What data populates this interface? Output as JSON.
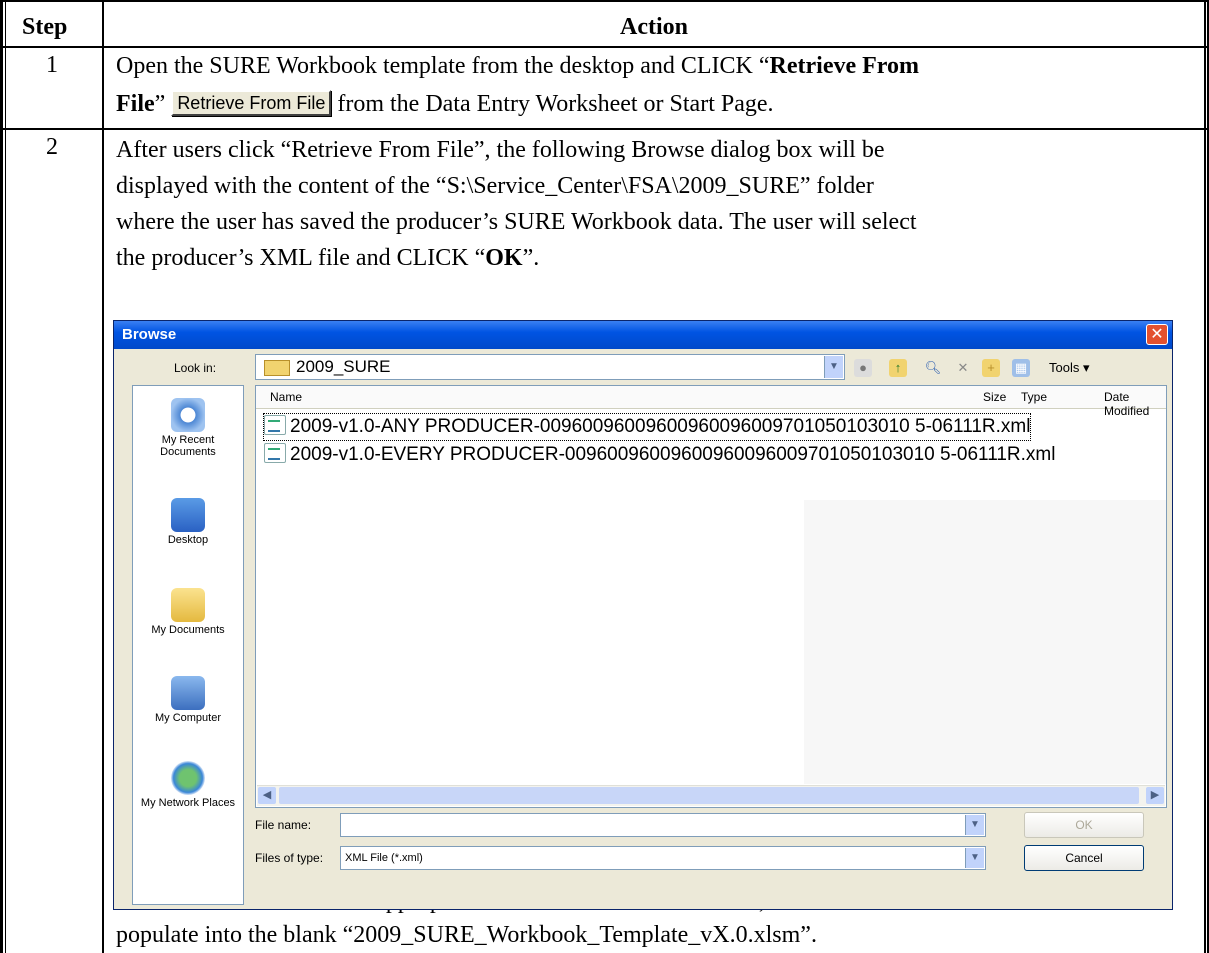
{
  "table": {
    "header_step": "Step",
    "header_action": "Action"
  },
  "step1": {
    "number": "1",
    "line1_pre": "Open the SURE Workbook template from the desktop and CLICK “",
    "line1_bold": "Retrieve From",
    "line2_bold": "File",
    "line2_mid": "”",
    "button_label": "Retrieve From File",
    "line2_post": "from the Data Entry Worksheet or Start Page."
  },
  "step2": {
    "number": "2",
    "line1": "After users click “Retrieve From File”, the following Browse dialog box will be",
    "line2": "displayed with the content of the “S:\\Service_Center\\FSA\\2009_SURE” folder",
    "line3": "where the user has saved the producer’s SURE Workbook data.  The user will select",
    "line4_pre": "the producer’s XML file and CLICK “",
    "line4_bold": "OK",
    "line4_post": "”.",
    "after_line1": "After user has selected the appropriate XML file and clicked “OK”, the data will",
    "after_line2": "populate into the blank “2009_SURE_Workbook_Template_vX.0.xlsm”."
  },
  "dialog": {
    "title": "Browse",
    "close_icon": "close-icon",
    "look_in_label": "Look in:",
    "look_in_value": "2009_SURE",
    "tools_label": "Tools ▾",
    "places": [
      "My Recent Documents",
      "Desktop",
      "My Documents",
      "My Computer",
      "My Network Places"
    ],
    "columns": {
      "name": "Name",
      "size": "Size",
      "type": "Type",
      "modified": "Date Modified"
    },
    "files": [
      "2009-v1.0-ANY PRODUCER-00960096009600960096009701050103010 5-06111R.xml",
      "2009-v1.0-EVERY PRODUCER-00960096009600960096009701050103010 5-06111R.xml"
    ],
    "file_name_label": "File name:",
    "file_name_value": "",
    "files_of_type_label": "Files of type:",
    "files_of_type_value": "XML File (*.xml)",
    "ok_label": "OK",
    "cancel_label": "Cancel"
  }
}
